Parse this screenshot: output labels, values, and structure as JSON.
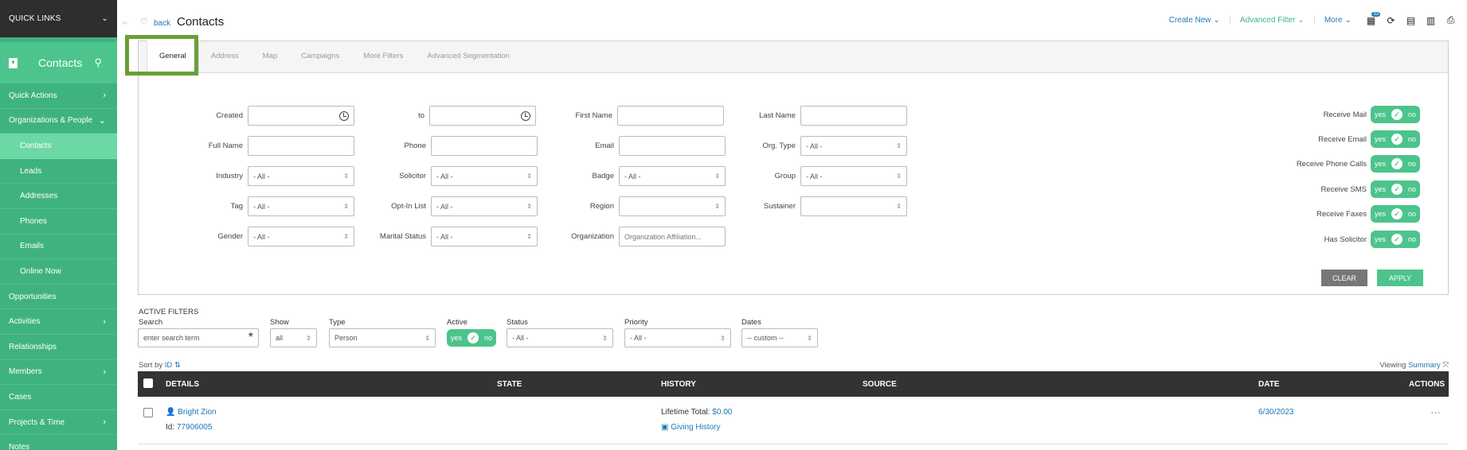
{
  "sidebar": {
    "quick_links": "QUICK LINKS",
    "section": "Contacts",
    "items": [
      {
        "label": "Quick Actions"
      },
      {
        "label": "Organizations & People"
      },
      {
        "label": "Contacts"
      },
      {
        "label": "Leads"
      },
      {
        "label": "Addresses"
      },
      {
        "label": "Phones"
      },
      {
        "label": "Emails"
      },
      {
        "label": "Online Now"
      },
      {
        "label": "Opportunities"
      },
      {
        "label": "Activities"
      },
      {
        "label": "Relationships"
      },
      {
        "label": "Members"
      },
      {
        "label": "Cases"
      },
      {
        "label": "Projects & Time"
      },
      {
        "label": "Notes"
      }
    ]
  },
  "header": {
    "back": "back",
    "title": "Contacts",
    "create_new": "Create New",
    "advanced_filter": "Advanced Filter",
    "more": "More",
    "badge": "33"
  },
  "tabs": [
    "General",
    "Address",
    "Map",
    "Campaigns",
    "More Filters",
    "Advanced Segmentation"
  ],
  "filters": {
    "created": "Created",
    "to": "to",
    "first_name": "First Name",
    "last_name": "Last Name",
    "full_name": "Full Name",
    "phone": "Phone",
    "email": "Email",
    "org_type": "Org. Type",
    "industry": "Industry",
    "solicitor": "Solicitor",
    "badge": "Badge",
    "group": "Group",
    "tag": "Tag",
    "opt_in_list": "Opt-In List",
    "region": "Region",
    "sustainer": "Sustainer",
    "gender": "Gender",
    "marital_status": "Marital Status",
    "organization": "Organization",
    "all": "- All -",
    "org_placeholder": "Organization Affiliation..."
  },
  "toggles": [
    {
      "label": "Receive Mail"
    },
    {
      "label": "Receive Email"
    },
    {
      "label": "Receive Phone Calls"
    },
    {
      "label": "Receive SMS"
    },
    {
      "label": "Receive Faxes"
    },
    {
      "label": "Has Solicitor"
    }
  ],
  "toggle_yes": "yes",
  "toggle_no": "no",
  "buttons": {
    "clear": "CLEAR",
    "apply": "APPLY"
  },
  "active_filters": {
    "title": "ACTIVE FILTERS",
    "search_label": "Search",
    "search_placeholder": "enter search term",
    "show_label": "Show",
    "show_value": "all",
    "type_label": "Type",
    "type_value": "Person",
    "active_label": "Active",
    "status_label": "Status",
    "status_value": "- All -",
    "priority_label": "Priority",
    "priority_value": "- All -",
    "dates_label": "Dates",
    "dates_value": "-- custom --"
  },
  "sort": {
    "label": "Sort by",
    "field": "ID"
  },
  "viewing": {
    "label": "Viewing",
    "value": "Summary"
  },
  "table": {
    "columns": [
      "DETAILS",
      "STATE",
      "HISTORY",
      "SOURCE",
      "DATE",
      "ACTIONS"
    ],
    "rows": [
      {
        "name": "Bright Zion",
        "id_label": "Id:",
        "id": "77906005",
        "lifetime_label": "Lifetime Total:",
        "lifetime": "$0.00",
        "giving": "Giving History",
        "date": "6/30/2023"
      }
    ]
  },
  "colors": {
    "sidebar": "#3fb37f",
    "accent": "#4cc48c",
    "link": "#1f78b4",
    "highlight": "#6a9e3a"
  }
}
